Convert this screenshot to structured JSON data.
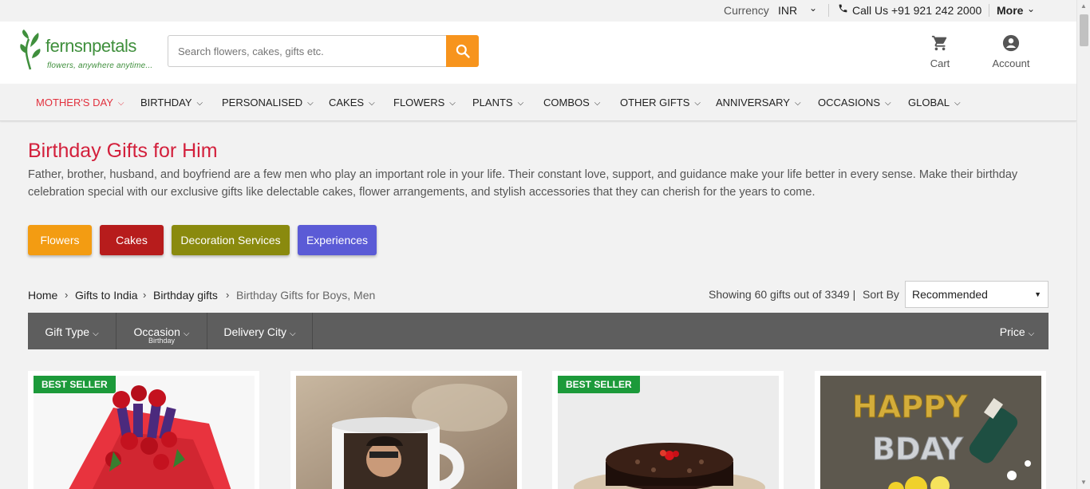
{
  "topbar": {
    "currency_label": "Currency",
    "currency_value": "INR",
    "call_label": "Call Us +91 921 242 2000",
    "more_label": "More"
  },
  "header": {
    "logo_name": "fernsnpetals",
    "logo_tagline": "flowers, anywhere anytime...",
    "search_placeholder": "Search flowers, cakes, gifts etc.",
    "cart_label": "Cart",
    "account_label": "Account"
  },
  "nav": [
    {
      "label": "MOTHER'S DAY"
    },
    {
      "label": "BIRTHDAY"
    },
    {
      "label": "PERSONALISED"
    },
    {
      "label": "CAKES"
    },
    {
      "label": "FLOWERS"
    },
    {
      "label": "PLANTS"
    },
    {
      "label": "COMBOS"
    },
    {
      "label": "OTHER GIFTS"
    },
    {
      "label": "ANNIVERSARY"
    },
    {
      "label": "OCCASIONS"
    },
    {
      "label": "GLOBAL"
    }
  ],
  "page": {
    "title": "Birthday Gifts for Him",
    "description": "Father, brother, husband, and boyfriend are a few men who play an important role in your life. Their constant love, support, and guidance make your life better in every sense. Make their birthday celebration special with our exclusive gifts like delectable cakes, flower arrangements, and stylish accessories that they can cherish for the years to come."
  },
  "chips": [
    {
      "label": "Flowers",
      "color": "#f39c12"
    },
    {
      "label": "Cakes",
      "color": "#b71c1c"
    },
    {
      "label": "Decoration Services",
      "color": "#8a8a0e"
    },
    {
      "label": "Experiences",
      "color": "#5b5bd6"
    }
  ],
  "breadcrumb": [
    "Home",
    "Gifts to India",
    "Birthday gifts",
    "Birthday Gifts for Boys, Men"
  ],
  "results": {
    "showing": "Showing 60 gifts out of 3349 |",
    "sort_label": "Sort By",
    "sort_value": "Recommended"
  },
  "filters": {
    "gift_type": "Gift Type",
    "occasion": "Occasion",
    "occasion_sub": "Birthday",
    "delivery_city": "Delivery City",
    "price": "Price"
  },
  "products": [
    {
      "badge": "BEST SELLER"
    },
    {
      "badge": ""
    },
    {
      "badge": "BEST SELLER"
    },
    {
      "badge": ""
    }
  ],
  "colors": {
    "accent": "#f7941d",
    "brand_green": "#3f8f3c",
    "title_red": "#d3203c",
    "badge_green": "#1c9a3a"
  }
}
